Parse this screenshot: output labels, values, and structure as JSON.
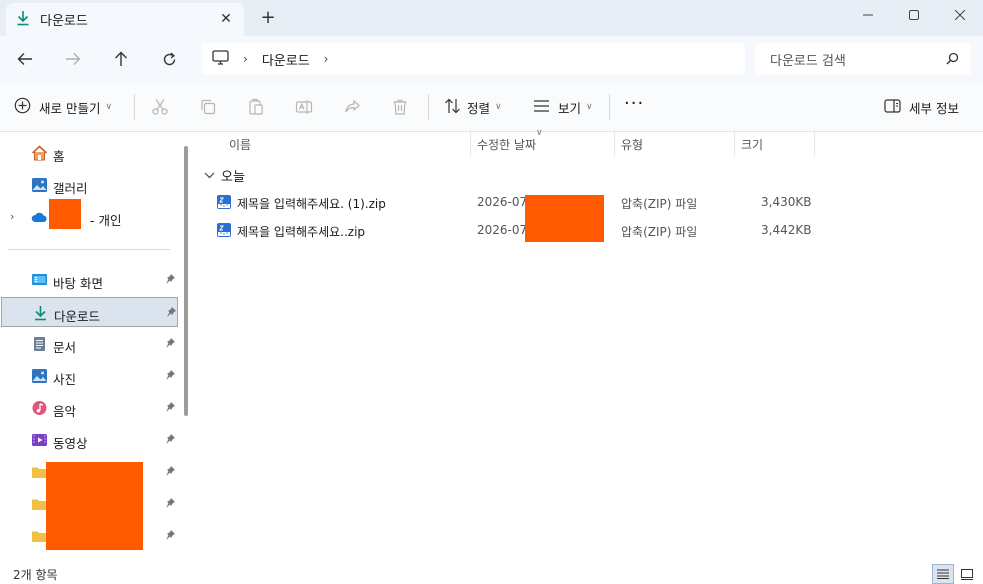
{
  "window": {
    "tab_title": "다운로드",
    "tab_close": "✕",
    "new_tab": "+"
  },
  "address": {
    "breadcrumb": [
      "다운로드"
    ],
    "search_placeholder": "다운로드 검색"
  },
  "toolbar": {
    "new_label": "새로 만들기",
    "sort_label": "정렬",
    "view_label": "보기",
    "more_label": "···",
    "details_label": "세부 정보"
  },
  "sidebar": {
    "top_items": [
      {
        "label": "홈",
        "icon": "home-icon"
      },
      {
        "label": "갤러리",
        "icon": "gallery-icon"
      },
      {
        "label": "- 개인",
        "icon": "onedrive-icon"
      }
    ],
    "quick_access": [
      {
        "label": "바탕 화면",
        "icon": "desktop-icon",
        "pinned": true
      },
      {
        "label": "다운로드",
        "icon": "download-icon",
        "pinned": true,
        "selected": true
      },
      {
        "label": "문서",
        "icon": "documents-icon",
        "pinned": true
      },
      {
        "label": "사진",
        "icon": "pictures-icon",
        "pinned": true
      },
      {
        "label": "음악",
        "icon": "music-icon",
        "pinned": true
      },
      {
        "label": "동영상",
        "icon": "videos-icon",
        "pinned": true
      }
    ],
    "redacted_folders": 3
  },
  "columns": {
    "name": "이름",
    "date": "수정한 날짜",
    "type": "유형",
    "size": "크기"
  },
  "group": {
    "label": "오늘"
  },
  "files": [
    {
      "name": "제목을 입력해주세요. (1).zip",
      "date": "2026-07",
      "type": "압축(ZIP) 파일",
      "size": "3,430KB"
    },
    {
      "name": "제목을 입력해주세요..zip",
      "date": "2026-07",
      "type": "압축(ZIP) 파일",
      "size": "3,442KB"
    }
  ],
  "status": {
    "item_count": "2개 항목"
  },
  "colors": {
    "accent": "#0f7b6c",
    "redaction": "#ff5a00",
    "selection": "#dbe3ee",
    "titlebar": "#e8eef6"
  }
}
